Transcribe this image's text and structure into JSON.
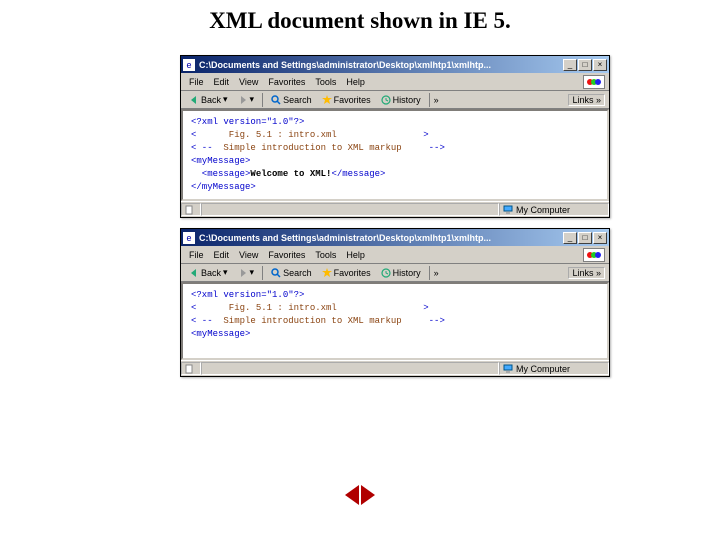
{
  "title": "XML document shown in IE 5.",
  "window": {
    "caption": "C:\\Documents and Settings\\administrator\\Desktop\\xmlhtp1\\xmlhtp...",
    "min": "_",
    "max": "□",
    "close": "×"
  },
  "menu": [
    "File",
    "Edit",
    "View",
    "Favorites",
    "Tools",
    "Help"
  ],
  "toolbar": {
    "back": "Back",
    "search": "Search",
    "favorites": "Favorites",
    "history": "History",
    "links": "Links",
    "chevron": "»"
  },
  "xml1": {
    "l1": "<?xml version=\"1.0\"?>",
    "l2_open": "<",
    "l2_text": "      Fig. 5.1 : intro.xml",
    "l2_close": ">",
    "l3_open": "< --",
    "l3_text": "  Simple introduction to XML markup",
    "l3_close": "-->",
    "l4": "<myMessage>",
    "l5_open": "  <message>",
    "l5_text": "Welcome to XML!",
    "l5_close": "</message>",
    "l6": "</myMessage>"
  },
  "xml2": {
    "l1": "<?xml version=\"1.0\"?>",
    "l2_open": "<",
    "l2_text": "      Fig. 5.1 : intro.xml",
    "l2_close": ">",
    "l3_open": "< --",
    "l3_text": "  Simple introduction to XML markup",
    "l3_close": "-->",
    "l4": "<myMessage>"
  },
  "status": {
    "zone": "My Computer"
  },
  "icons": {
    "ie": "e",
    "msn": "msn"
  }
}
